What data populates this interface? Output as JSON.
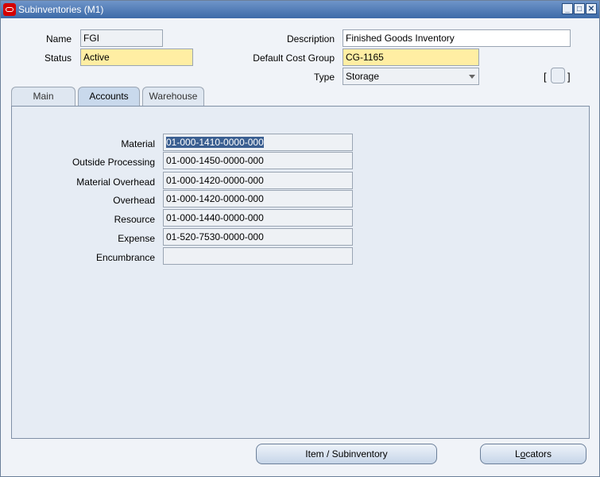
{
  "window": {
    "title": "Subinventories (M1)"
  },
  "header": {
    "name_label": "Name",
    "name_value": "FGI",
    "status_label": "Status",
    "status_value": "Active",
    "description_label": "Description",
    "description_value": "Finished Goods Inventory",
    "cost_group_label": "Default Cost Group",
    "cost_group_value": "CG-1165",
    "type_label": "Type",
    "type_value": "Storage",
    "bracket_left": "[",
    "bracket_right": "]"
  },
  "tabs": [
    {
      "label": "Main"
    },
    {
      "label": "Accounts"
    },
    {
      "label": "Warehouse"
    }
  ],
  "accounts": [
    {
      "label": "Material",
      "value": "01-000-1410-0000-000"
    },
    {
      "label": "Outside Processing",
      "value": "01-000-1450-0000-000"
    },
    {
      "label": "Material Overhead",
      "value": "01-000-1420-0000-000"
    },
    {
      "label": "Overhead",
      "value": "01-000-1420-0000-000"
    },
    {
      "label": "Resource",
      "value": "01-000-1440-0000-000"
    },
    {
      "label": "Expense",
      "value": "01-520-7530-0000-000"
    },
    {
      "label": "Encumbrance",
      "value": ""
    }
  ],
  "buttons": {
    "item_subinventory": "Item / Subinventory",
    "locators_prefix": "L",
    "locators_underlined": "o",
    "locators_suffix": "cators"
  },
  "colors": {
    "titlebar": "#3c6aa8",
    "required_field": "#ffeea3",
    "selection": "#3b5f91"
  }
}
